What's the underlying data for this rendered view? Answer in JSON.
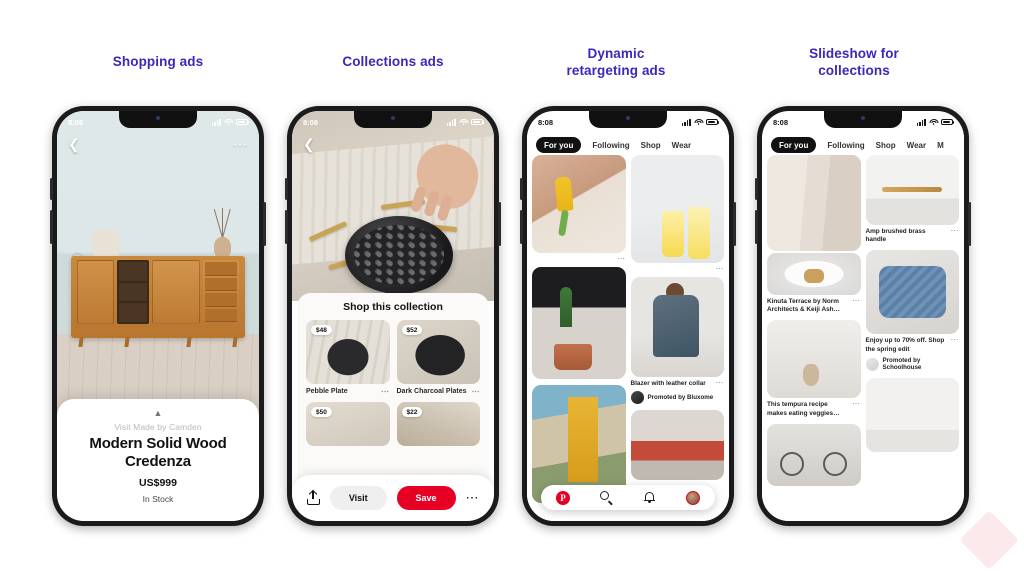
{
  "page": {
    "background": "#ffffff",
    "accent_heading_color": "#3a29b8",
    "brand_red": "#e60023"
  },
  "headings": [
    {
      "line1": "Shopping ads",
      "line2": ""
    },
    {
      "line1": "Collections ads",
      "line2": ""
    },
    {
      "line1": "Dynamic",
      "line2": "retargeting ads"
    },
    {
      "line1": "Slideshow for",
      "line2": "collections"
    }
  ],
  "status_bar": {
    "time": "8:08",
    "signal_icon": "cellular-bars-icon",
    "wifi_icon": "wifi-icon",
    "battery_icon": "battery-icon"
  },
  "phone1": {
    "back_icon": "back-chevron-icon",
    "more_icon": "overflow-dots-icon",
    "card": {
      "expand_icon": "chevron-up-icon",
      "visit": "Visit Made by Camden",
      "title_line1": "Modern Solid Wood",
      "title_line2": "Credenza",
      "price": "US$999",
      "stock": "In Stock"
    }
  },
  "phone2": {
    "back_icon": "back-chevron-icon",
    "sheet_title": "Shop this collection",
    "products": [
      {
        "price": "$48",
        "name": "Pebble Plate",
        "more_icon": "overflow-dots-icon"
      },
      {
        "price": "$52",
        "name": "Dark Charcoal Plates",
        "more_icon": "overflow-dots-icon"
      },
      {
        "price": "$50",
        "name": "",
        "more_icon": "overflow-dots-icon"
      },
      {
        "price": "$22",
        "name": "",
        "more_icon": "overflow-dots-icon"
      }
    ],
    "actions": {
      "share_icon": "share-icon",
      "visit_label": "Visit",
      "save_label": "Save",
      "more_icon": "overflow-dots-icon"
    }
  },
  "phone3": {
    "tabs": [
      "For you",
      "Following",
      "Shop",
      "Wear"
    ],
    "active_tab": "For you",
    "pins": [
      {
        "caption": "",
        "promoter": ""
      },
      {
        "caption": "",
        "promoter": ""
      },
      {
        "caption": "",
        "promoter": ""
      },
      {
        "caption": "Blazer with leather collar",
        "promoter": "Promoted by Bluxome"
      },
      {
        "caption": "",
        "promoter": ""
      }
    ],
    "nav": {
      "home_icon": "pinterest-home-icon",
      "search_icon": "search-icon",
      "notifications_icon": "bell-icon",
      "profile_icon": "avatar-icon"
    }
  },
  "phone4": {
    "tabs": [
      "For you",
      "Following",
      "Shop",
      "Wear",
      "M"
    ],
    "active_tab": "For you",
    "pins": [
      {
        "caption": "Kinuta Terrace by Norm Architects & Keiji Ash…",
        "promoter": ""
      },
      {
        "caption": "Amp brushed brass handle",
        "promoter": ""
      },
      {
        "caption": "This tempura recipe makes eating veggies…",
        "promoter": ""
      },
      {
        "caption": "Enjoy up to 70% off. Shop the spring edit",
        "promoter": "Promoted by Schoolhouse"
      }
    ]
  },
  "watermark": {
    "label": "",
    "icon": "diamond-watermark-icon"
  }
}
